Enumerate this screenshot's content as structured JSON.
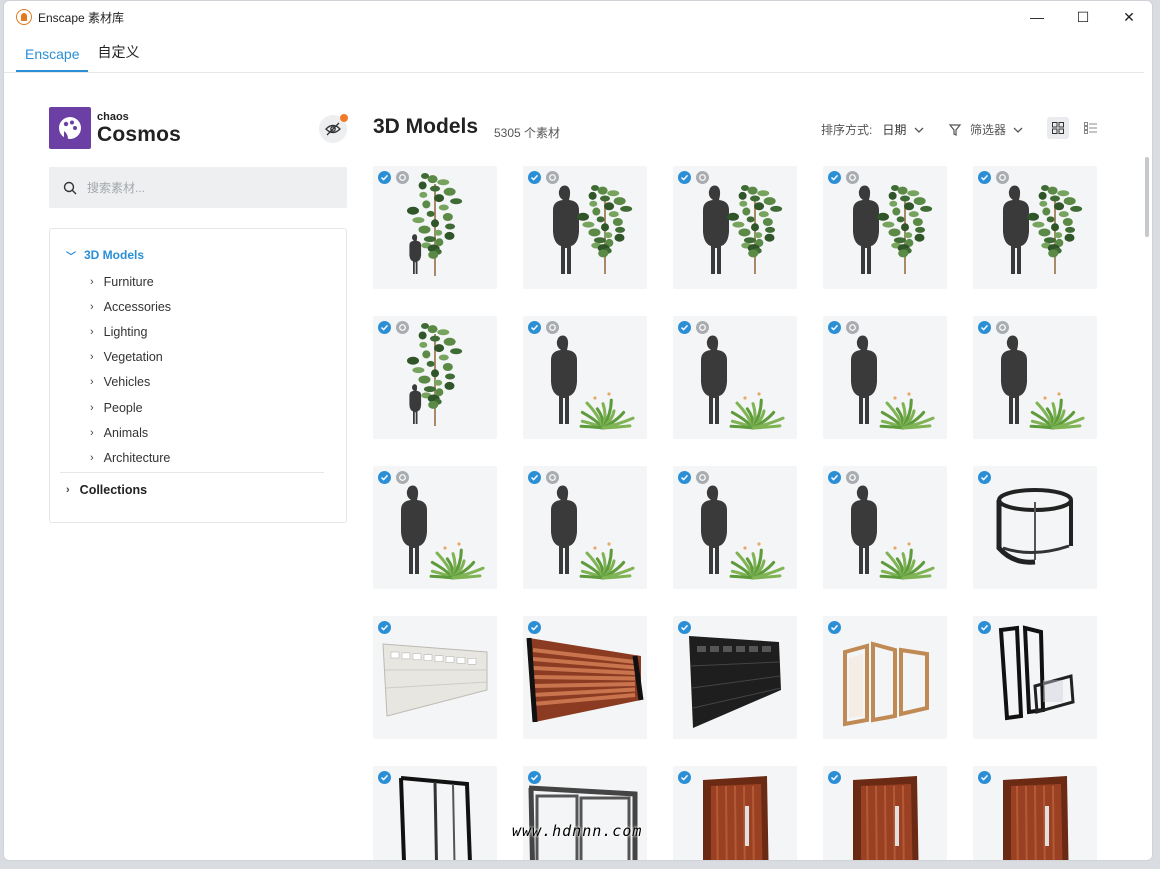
{
  "window": {
    "title": "Enscape 素材库",
    "controls": [
      "—",
      "☐",
      "✕"
    ]
  },
  "tabs": [
    {
      "label": "Enscape",
      "active": true
    },
    {
      "label": "自定义",
      "active": false
    }
  ],
  "brand": {
    "small": "chaos",
    "name": "Cosmos",
    "color": "#6b3fa3"
  },
  "search": {
    "placeholder": "搜索素材..."
  },
  "tree": {
    "root": "3D Models",
    "items": [
      "Furniture",
      "Accessories",
      "Lighting",
      "Vegetation",
      "Vehicles",
      "People",
      "Animals",
      "Architecture"
    ],
    "collections": "Collections"
  },
  "main": {
    "title": "3D Models",
    "count": "5305 个素材",
    "sort_label": "排序方式:",
    "sort_value": "日期",
    "filter_label": "筛选器"
  },
  "accent_color": "#2b8fd6",
  "grid": [
    {
      "kind": "tree-tall",
      "second_badge": true
    },
    {
      "kind": "person-tree",
      "second_badge": true
    },
    {
      "kind": "person-tree",
      "second_badge": true
    },
    {
      "kind": "person-tree",
      "second_badge": true
    },
    {
      "kind": "person-tree",
      "second_badge": true
    },
    {
      "kind": "tree-tall",
      "second_badge": true
    },
    {
      "kind": "person-plant",
      "second_badge": true
    },
    {
      "kind": "person-plant",
      "second_badge": true
    },
    {
      "kind": "person-plant",
      "second_badge": true
    },
    {
      "kind": "person-plant",
      "second_badge": true
    },
    {
      "kind": "person-plant",
      "second_badge": true
    },
    {
      "kind": "person-plant",
      "second_badge": true
    },
    {
      "kind": "person-plant",
      "second_badge": true
    },
    {
      "kind": "person-plant",
      "second_badge": true
    },
    {
      "kind": "revolving-door",
      "second_badge": false
    },
    {
      "kind": "garage-white",
      "second_badge": false
    },
    {
      "kind": "fence-wood",
      "second_badge": false
    },
    {
      "kind": "garage-black",
      "second_badge": false
    },
    {
      "kind": "folding-door",
      "second_badge": false
    },
    {
      "kind": "glass-door",
      "second_badge": false
    },
    {
      "kind": "frame-door",
      "second_badge": false
    },
    {
      "kind": "sliding-door",
      "second_badge": false
    },
    {
      "kind": "wood-door",
      "second_badge": false
    },
    {
      "kind": "wood-door",
      "second_badge": false
    },
    {
      "kind": "wood-door",
      "second_badge": false
    }
  ],
  "watermark": "www.hdnnn.com"
}
